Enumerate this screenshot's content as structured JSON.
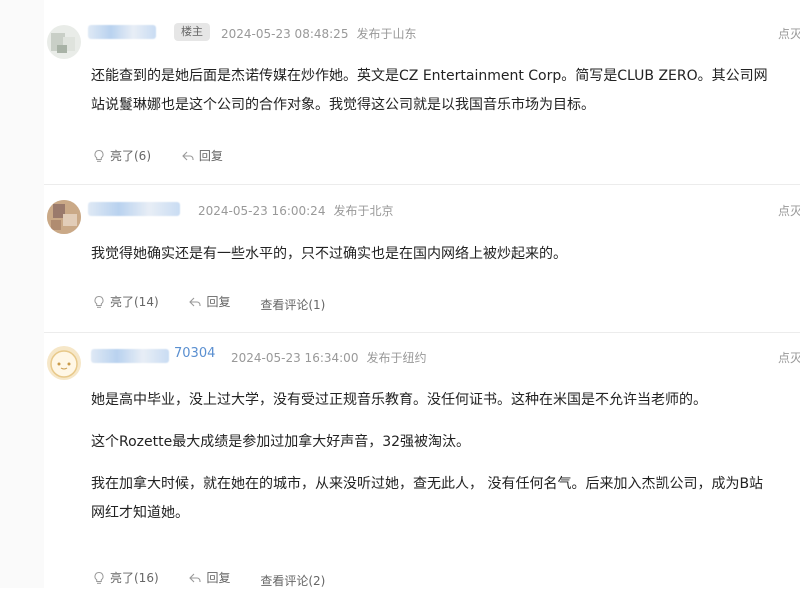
{
  "comments": [
    {
      "username_visible": "",
      "badge": "楼主",
      "date": "2024-05-23 08:48:25",
      "location": "发布于山东",
      "report": "点灭",
      "paragraphs": [
        "还能查到的是她后面是杰诺传媒在炒作她。英文是CZ Entertainment Corp。简写是CLUB ZERO。其公司网站说鬘琳娜也是这个公司的合作对象。我觉得这公司就是以我国音乐市场为目标。"
      ],
      "like_label": "亮了(6)",
      "reply_label": "回复"
    },
    {
      "username_visible": "",
      "date": "2024-05-23 16:00:24",
      "location": "发布于北京",
      "report": "点灭",
      "paragraphs": [
        "我觉得她确实还是有一些水平的，只不过确实也是在国内网络上被炒起来的。"
      ],
      "like_label": "亮了(14)",
      "reply_label": "回复",
      "view_label": "查看评论(1)"
    },
    {
      "username_visible": "70304",
      "date": "2024-05-23 16:34:00",
      "location": "发布于纽约",
      "report": "点灭",
      "paragraphs": [
        "她是高中毕业，没上过大学，没有受过正规音乐教育。没任何证书。这种在米国是不允许当老师的。",
        "这个Rozette最大成绩是参加过加拿大好声音，32强被淘汰。",
        "我在加拿大时候，就在她在的城市，从来没听过她，查无此人， 没有任何名气。后来加入杰凯公司，成为B站网红才知道她。"
      ],
      "like_label": "亮了(16)",
      "reply_label": "回复",
      "view_label": "查看评论(2)"
    }
  ],
  "colors": {
    "meta": "#999999",
    "text": "#222222",
    "badge_bg": "#e6e6e6",
    "divider": "#ececec"
  },
  "icons": {
    "like": "lightbulb-icon",
    "reply": "reply-arrow-icon"
  }
}
